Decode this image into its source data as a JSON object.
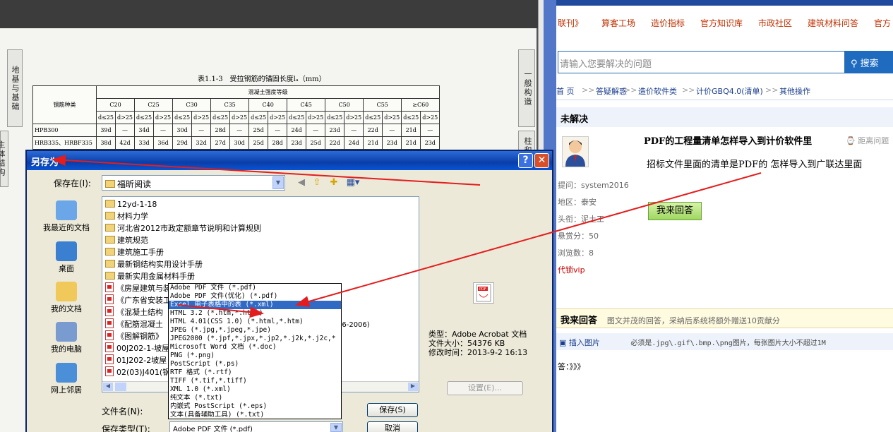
{
  "pdf_viewer": {
    "side_tab_left": "地基与基础",
    "side_tab_left2": "主体结构",
    "side_tab_right": "一般构造",
    "side_tab_right2": "柱和节点",
    "table_title": "表1.1-3　受拉钢筋的锚固长度lₐ（mm）",
    "table": {
      "corner": "钢筋种类",
      "group_header": "混凝土强度等级",
      "grades": [
        "C20",
        "C25",
        "C30",
        "C35",
        "C40",
        "C45",
        "C50",
        "C55",
        "≥C60"
      ],
      "subheaders": [
        "d≤25",
        "d>25"
      ],
      "rows": [
        {
          "name": "HPB300",
          "cells": [
            "39d",
            "—",
            "34d",
            "—",
            "30d",
            "—",
            "28d",
            "—",
            "25d",
            "—",
            "24d",
            "—",
            "23d",
            "—",
            "22d",
            "—",
            "21d",
            "—"
          ]
        },
        {
          "name": "HRB335、HRBF335",
          "cells": [
            "38d",
            "42d",
            "33d",
            "36d",
            "29d",
            "32d",
            "27d",
            "30d",
            "25d",
            "28d",
            "23d",
            "25d",
            "22d",
            "24d",
            "21d",
            "23d",
            "21d",
            "23d"
          ]
        }
      ]
    }
  },
  "dialog": {
    "title": "另存为",
    "help": "?",
    "close": "✕",
    "save_in_label": "保存在(I):",
    "save_in_value": "福昕阅读",
    "places": [
      "我最近的文档",
      "桌面",
      "我的文档",
      "我的电脑",
      "网上邻居"
    ],
    "files": [
      {
        "type": "folder",
        "name": "12yd-1-18"
      },
      {
        "type": "folder",
        "name": "材料力学"
      },
      {
        "type": "folder",
        "name": "河北省2012市政定额章节说明和计算规则"
      },
      {
        "type": "folder",
        "name": "建筑规范"
      },
      {
        "type": "folder",
        "name": "建筑施工手册"
      },
      {
        "type": "folder",
        "name": "最新钢结构实用设计手册"
      },
      {
        "type": "folder",
        "name": "最新实用金属材料手册"
      },
      {
        "type": "pdf",
        "name": "《房屋建筑与装饰工程工程量计算规范》"
      },
      {
        "type": "pdf",
        "name": "《广东省安装工程"
      },
      {
        "type": "pdf",
        "name": "《混凝土结构"
      },
      {
        "type": "pdf",
        "name": "《配筋混凝土"
      },
      {
        "type": "pdf",
        "name": "《图解钢筋》"
      },
      {
        "type": "pdf",
        "name": "00J202-1-坡屋"
      },
      {
        "type": "pdf",
        "name": "01J202-2坡屋"
      },
      {
        "type": "pdf",
        "name": "02(03)J401(钢"
      }
    ],
    "file_suffix_extra": "06-2006)",
    "file_info": {
      "type": "类型：Adobe Acrobat 文档",
      "size": "文件大小：54376 KB",
      "modified": "修改时间：2013-9-2 16:13"
    },
    "settings": "设置(E)...",
    "filename_label": "文件名(N):",
    "filetype_label": "保存类型(T):",
    "filetype_value": "Adobe PDF 文件 (*.pdf)",
    "save": "保存(S)",
    "cancel": "取消",
    "type_options": [
      "Adobe PDF 文件 (*.pdf)",
      "Adobe PDF 文件(优化) (*.pdf)",
      "Excel 电子表格中的表 (*.xml)",
      "HTML 3.2 (*.htm,*.html)",
      "HTML 4.01(CSS 1.0) (*.html,*.htm)",
      "JPEG (*.jpg,*.jpeg,*.jpe)",
      "JPEG2000 (*.jpf,*.jpx,*.jp2,*.j2k,*.j2c,*",
      "Microsoft Word 文档 (*.doc)",
      "PNG (*.png)",
      "PostScript (*.ps)",
      "RTF 格式 (*.rtf)",
      "TIFF (*.tif,*.tiff)",
      "XML 1.0 (*.xml)",
      "纯文本 (*.txt)",
      "内嵌式 PostScript (*.eps)",
      "文本(具备辅助工具) (*.txt)"
    ],
    "selected_option": 2
  },
  "web": {
    "nav": [
      "联刊》",
      "算客工场",
      "造价指标",
      "官方知识库",
      "市政社区",
      "建筑材料问答",
      "官方"
    ],
    "search_placeholder": "请输入您要解决的问题",
    "search_button": "搜索",
    "breadcrumb": [
      "首 页",
      "答疑解惑",
      "造价软件类",
      "计价GBQ4.0(清单)",
      "其他操作"
    ],
    "breadcrumb_sep": ">>",
    "status": "未解决",
    "question_title": "PDF的工程量清单怎样导入到计价软件里",
    "question_distance": "距离问题",
    "question_body": "招标文件里面的清单是PDF的 怎样导入到广联达里面",
    "meta": [
      "提问：system2016",
      "地区：泰安",
      "头衔：泥土工",
      "悬赏分：50",
      "浏览数：8",
      "代锁vip"
    ],
    "answer_button": "我来回答",
    "answer_section_title": "我来回答",
    "answer_section_note": "图文并茂的回答，采纳后系统将额外赠送10贡献分",
    "insert_image": "插入图片",
    "insert_note": "必须是.jpg\\.gif\\.bmp.\\png图片，每张图片大小不超过1M",
    "answer_label": "答：》》》"
  },
  "colors": {
    "annotation": "#e31d1d",
    "titlebar": "#0a3ea8",
    "selection": "#316ac5",
    "link": "#c03000"
  }
}
